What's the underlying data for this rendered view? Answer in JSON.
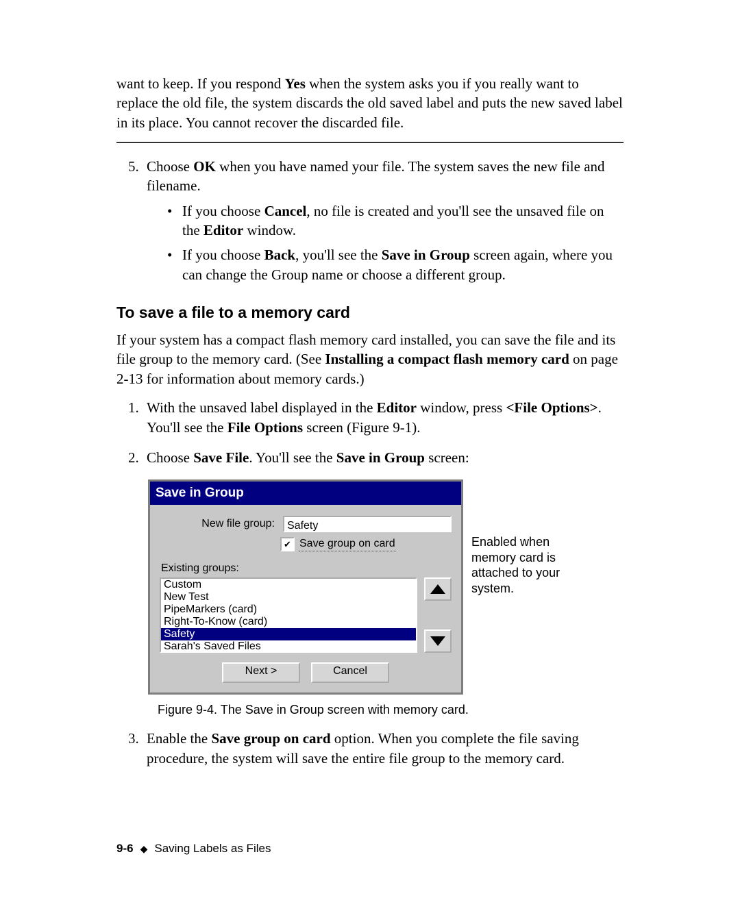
{
  "para0": {
    "pre": "want to keep. If you respond ",
    "yes": "Yes",
    "post": " when the system asks you if you really want to replace the old file, the system discards the old saved label and puts the new saved label in its place. You cannot recover the discarded file."
  },
  "step5": {
    "pre": "Choose ",
    "ok": "OK",
    "post": " when you have named your file. The system saves the new file and filename.",
    "bullet1": {
      "pre": "If you choose ",
      "cancel": "Cancel",
      "mid": ", no file is created and you'll see the unsaved file on the ",
      "editor": "Editor",
      "post": " window."
    },
    "bullet2": {
      "pre": "If you choose ",
      "back": "Back",
      "mid": ", you'll see the ",
      "sig": "Save in Group",
      "post": " screen again, where you can change the Group name or choose a different group."
    }
  },
  "sectionTitle": "To save a file to a memory card",
  "sectionPara": {
    "pre": "If your system has a compact flash memory card installed, you can save the file and its file group to the memory card. (See ",
    "ref": "Installing a compact flash memory card",
    "post": " on page 2-13 for information about memory cards.)"
  },
  "step1": {
    "pre": "With the unsaved label displayed in the ",
    "editor": "Editor",
    "mid": " window, press ",
    "fileopt": "<File Options>",
    "mid2": ". You'll see the ",
    "fileopt2": "File Options",
    "post": " screen (Figure 9-1)."
  },
  "step2": {
    "pre": "Choose ",
    "savefile": "Save File",
    "mid": ". You'll see the ",
    "sig": "Save in Group",
    "post": " screen:"
  },
  "dialog": {
    "title": "Save in Group",
    "newFileGroupLabel": "New file group:",
    "newFileGroupValue": "Safety",
    "saveOnCard": "Save group on card",
    "existingLabel": "Existing groups:",
    "items": [
      "Custom",
      "New Test",
      "PipeMarkers (card)",
      "Right-To-Know (card)",
      "Safety",
      "Sarah's Saved Files"
    ],
    "selectedIndex": 4,
    "nextBtn": "Next >",
    "cancelBtn": "Cancel"
  },
  "callout": "Enabled when memory card is attached to your system.",
  "figcaption": "Figure 9-4. The Save in Group screen with memory card.",
  "step3": {
    "pre": "Enable the ",
    "opt": "Save group on card",
    "post": " option. When you complete the file saving procedure, the system will save the entire file group to the memory card."
  },
  "footer": {
    "page": "9-6",
    "section": "Saving Labels as Files"
  }
}
